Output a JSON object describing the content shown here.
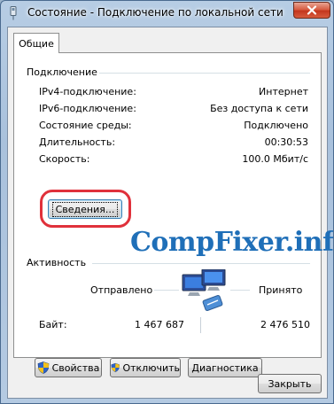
{
  "window": {
    "title": "Состояние - Подключение по локальной сети"
  },
  "tabs": [
    {
      "label": "Общие",
      "selected": true
    }
  ],
  "connection": {
    "heading": "Подключение",
    "rows": [
      {
        "label": "IPv4-подключение:",
        "value": "Интернет"
      },
      {
        "label": "IPv6-подключение:",
        "value": "Без доступа к сети"
      },
      {
        "label": "Состояние среды:",
        "value": "Подключено"
      },
      {
        "label": "Длительность:",
        "value": "00:30:53"
      },
      {
        "label": "Скорость:",
        "value": "100.0 Мбит/с"
      }
    ],
    "details_button": "Сведения..."
  },
  "watermark": "CompFixer.info",
  "activity": {
    "heading": "Активность",
    "sent_label": "Отправлено",
    "received_label": "Принято",
    "bytes_label": "Байт:",
    "bytes_sent": "1 467 687",
    "bytes_received": "2 476 510"
  },
  "buttons": {
    "properties": "Свойства",
    "disable": "Отключить",
    "diagnose": "Диагностика",
    "close": "Закрыть"
  },
  "colors": {
    "highlight": "#e0313b",
    "watermark": "#1f6fb8",
    "close_button": "#c2341c",
    "uac_shield": [
      "#2f64c8",
      "#f4c21b"
    ]
  },
  "icons": [
    "connection-icon",
    "close-icon",
    "network-activity-icon",
    "uac-shield-icon"
  ]
}
